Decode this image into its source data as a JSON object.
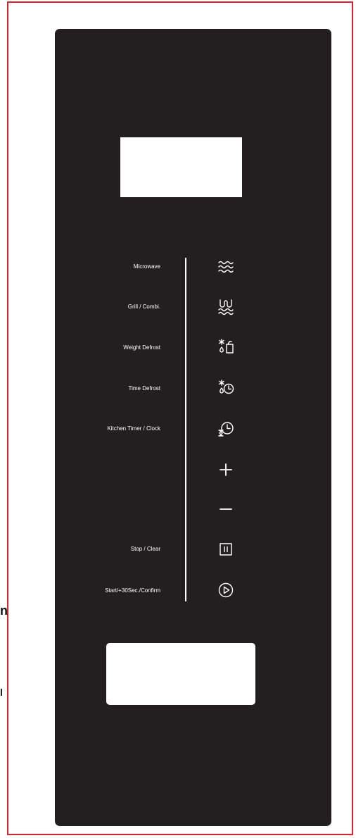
{
  "stray_text": [
    "n",
    "l"
  ],
  "labels": {
    "microwave": "Microwave",
    "grill": "Grill / Combi.",
    "weight_defrost": "Weight Defrost",
    "time_defrost": "Time Defrost",
    "kitchen_timer": "Kitchen Timer / Clock",
    "stop_clear": "Stop / Clear",
    "start": "Start/+30Sec./Confirm"
  },
  "icons": {
    "microwave": "microwave-waves-icon",
    "grill": "grill-icon",
    "weight_defrost": "weight-defrost-icon",
    "time_defrost": "time-defrost-icon",
    "kitchen_timer": "kitchen-timer-icon",
    "plus": "plus-icon",
    "minus": "minus-icon",
    "stop": "stop-pause-icon",
    "start": "start-play-icon"
  },
  "colors": {
    "panel": "#231f20",
    "frame": "#e0202a",
    "display": "#ffffff",
    "symbols": "#ffffff"
  }
}
